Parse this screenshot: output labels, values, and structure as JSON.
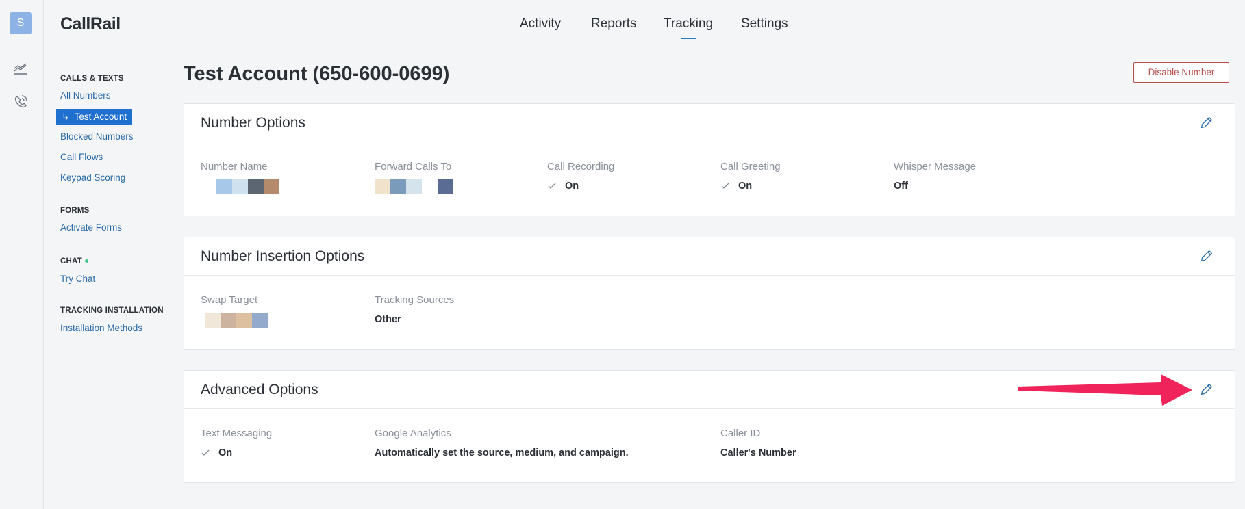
{
  "app": {
    "logo": "CallRail",
    "avatar_letter": "S"
  },
  "rail": {
    "icons": [
      "chart-line-icon",
      "phone-icon"
    ]
  },
  "topnav": {
    "tabs": [
      {
        "label": "Activity"
      },
      {
        "label": "Reports"
      },
      {
        "label": "Tracking",
        "active": true
      },
      {
        "label": "Settings"
      }
    ]
  },
  "sidenav": {
    "sections": [
      {
        "heading": "CALLS & TEXTS",
        "items": [
          "All Numbers",
          "Test Account",
          "Blocked Numbers",
          "Call Flows",
          "Keypad Scoring"
        ]
      },
      {
        "heading": "FORMS",
        "items": [
          "Activate Forms"
        ]
      },
      {
        "heading": "CHAT",
        "items": [
          "Try Chat"
        ]
      },
      {
        "heading": "TRACKING INSTALLATION",
        "items": [
          "Installation Methods"
        ]
      }
    ],
    "active_prefix": "↳"
  },
  "page": {
    "title": "Test Account (650-600-0699)",
    "disable_button": "Disable Number"
  },
  "cards": {
    "number_options": {
      "title": "Number Options",
      "fields": {
        "number_name": {
          "label": "Number Name",
          "swatches": [
            "#ffffff",
            "#a7c8e8",
            "#cfe0ef",
            "#5c6673",
            "#b48a6c"
          ]
        },
        "forward_calls": {
          "label": "Forward Calls To",
          "swatches": [
            "#f1e2cc",
            "#7b9bbb",
            "#d5e3ec",
            "#ffffff",
            "#5a6c93"
          ]
        },
        "call_recording": {
          "label": "Call Recording",
          "value": "On"
        },
        "call_greeting": {
          "label": "Call Greeting",
          "value": "On"
        },
        "whisper_message": {
          "label": "Whisper Message",
          "value": "Off"
        }
      }
    },
    "number_insertion": {
      "title": "Number Insertion Options",
      "fields": {
        "swap_target": {
          "label": "Swap Target",
          "swatches": [
            "#f1e7d9",
            "#ccb3a0",
            "#dcc0a0",
            "#93aacc"
          ]
        },
        "tracking_sources": {
          "label": "Tracking Sources",
          "value": "Other"
        }
      }
    },
    "advanced": {
      "title": "Advanced Options",
      "fields": {
        "text_messaging": {
          "label": "Text Messaging",
          "value": "On"
        },
        "google_analytics": {
          "label": "Google Analytics",
          "value": "Automatically set the source, medium, and campaign."
        },
        "caller_id": {
          "label": "Caller ID",
          "value": "Caller's Number"
        }
      }
    }
  },
  "colors": {
    "accent": "#1f6fcf",
    "link": "#2a6aa6",
    "danger": "#b9504c",
    "annotation_arrow": "#f0245a"
  }
}
